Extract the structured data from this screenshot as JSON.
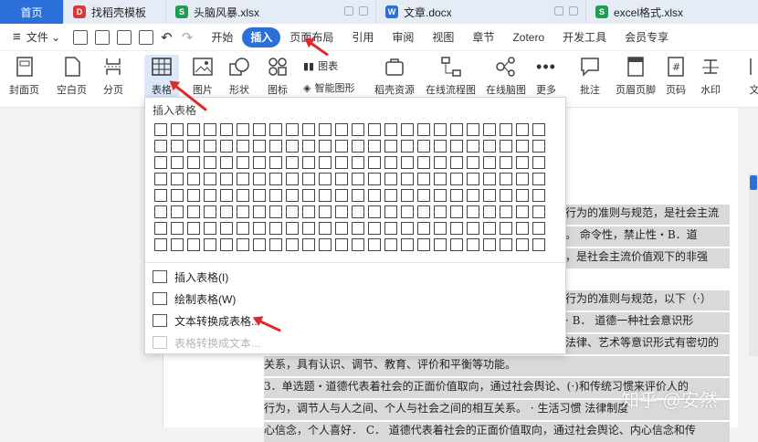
{
  "tabs": [
    {
      "label": "首页",
      "icon": "home-tab"
    },
    {
      "label": "找稻壳模板",
      "icon": "docer-icon",
      "color": "#d9383a",
      "glyph": "D"
    },
    {
      "label": "头脑风暴.xlsx",
      "icon": "excel-icon",
      "color": "#1f9d55",
      "glyph": "S"
    },
    {
      "label": "文章.docx",
      "icon": "word-icon",
      "color": "#2b6fd9",
      "glyph": "W"
    },
    {
      "label": "excel格式.xlsx",
      "icon": "excel-icon",
      "color": "#1f9d55",
      "glyph": "S"
    }
  ],
  "menu": {
    "file": "文件",
    "items": [
      "开始",
      "插入",
      "页面布局",
      "引用",
      "审阅",
      "视图",
      "章节",
      "Zotero",
      "开发工具",
      "会员专享"
    ],
    "active": "插入"
  },
  "ribbon": {
    "cover": "封面页",
    "blank": "空白页",
    "pagebreak": "分页",
    "table": "表格",
    "picture": "图片",
    "shape": "形状",
    "iconlib": "图标",
    "chart": "图表",
    "smartart": "智能图形",
    "docer": "稻壳资源",
    "flowchart": "在线流程图",
    "mindmap": "在线脑图",
    "more": "更多",
    "comment": "批注",
    "header": "页眉页脚",
    "pagenum": "页码",
    "watermark": "水印",
    "text": "文"
  },
  "dropdown": {
    "title": "插入表格",
    "insert": "插入表格(I)",
    "draw": "绘制表格(W)",
    "text2table": "文本转换成表格...",
    "table2text": "表格转换成文本..."
  },
  "doc_lines": [
    "行为的准则与规范，是社会主流",
    "。  命令性，禁止性・B．道",
    "，是社会主流价值观下的非强",
    "行为的准则与规范，以下（·）",
    "·   B． 道德一种社会意识形",
    "法律、艺术等意识形式有密切的",
    "关系，具有认识、调节、教育、评价和平衡等功能。",
    "3．单选题・道德代表着社会的正面价值取向，通过社会舆论、(·)和传统习惯来评价人的",
    "行为，调节人与人之间、个人与社会之间的相互关系。 · 生活习惯  法律制度",
    "心信念，个人喜好． C． 道德代表着社会的正面价值取向，通过社会舆论、内心信念和传"
  ],
  "watermark": "知乎 @安然",
  "colors": {
    "accent": "#2b6fd9",
    "arrow": "#e02a2a"
  }
}
